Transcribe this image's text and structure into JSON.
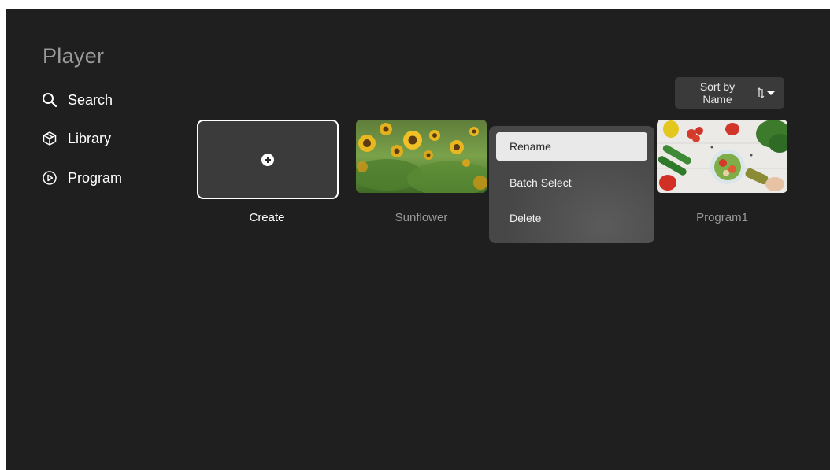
{
  "app": {
    "title": "Player"
  },
  "sidebar": {
    "items": [
      {
        "label": "Search",
        "icon": "search-icon"
      },
      {
        "label": "Library",
        "icon": "library-icon"
      },
      {
        "label": "Program",
        "icon": "program-icon"
      }
    ]
  },
  "sort": {
    "label_line1": "Sort by",
    "label_line2": "Name",
    "icon": "sort-icon"
  },
  "cards": {
    "create": {
      "label": "Create",
      "icon": "add-circle-icon"
    },
    "items": [
      {
        "label": "Sunflower"
      },
      {
        "label": "Program1"
      }
    ]
  },
  "context_menu": {
    "items": [
      {
        "label": "Rename",
        "selected": true
      },
      {
        "label": "Batch Select",
        "selected": false
      },
      {
        "label": "Delete",
        "selected": false
      }
    ]
  },
  "colors": {
    "background": "#1f1f1f",
    "menu_background": "#474747",
    "selected_item": "#e9e9e9",
    "muted_text": "#9a9a9a"
  }
}
